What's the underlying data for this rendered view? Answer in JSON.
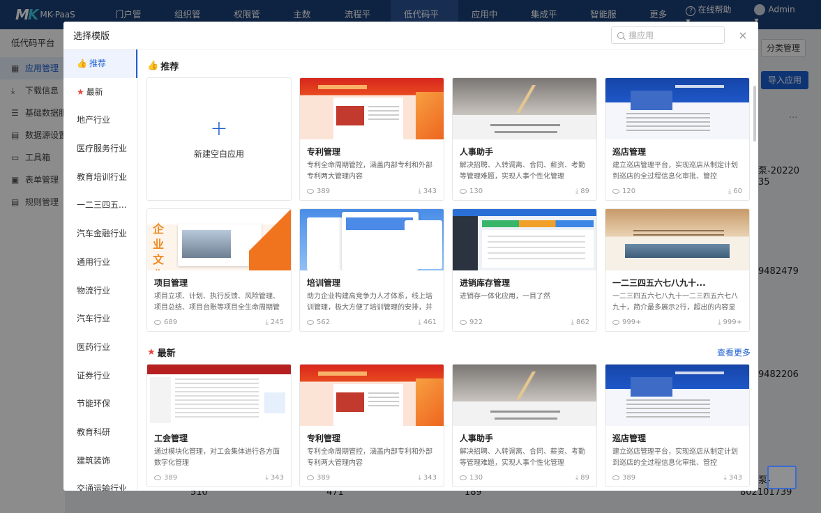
{
  "topbar": {
    "logo": "MK-PaaS",
    "nav": [
      "门户管理",
      "组织管理",
      "权限管理",
      "主数据",
      "流程平台",
      "低代码平台",
      "应用中心",
      "集成平台",
      "智能服务",
      "更多 ▾"
    ],
    "help": "在线帮助 ▾",
    "user": "Admin ▾"
  },
  "bg_sidebar": {
    "title": "低代码平台",
    "items": [
      "应用管理",
      "下载信息",
      "基础数据服务",
      "数据源设置",
      "工具箱",
      "表单管理",
      "规则管理"
    ]
  },
  "bg_right": {
    "category_btn": "分类管理",
    "import_btn": "导入应用",
    "dots": "···",
    "texts": [
      "泵-20220",
      "35",
      "9482479",
      "9482206",
      "泵-",
      "802101739"
    ],
    "bottom": [
      "510",
      "471",
      "189"
    ]
  },
  "modal": {
    "title": "选择模版",
    "search_placeholder": "搜应用",
    "close": "×",
    "categories": [
      "推荐",
      "最新",
      "地产行业",
      "医疗服务行业",
      "教育培训行业",
      "一二三四五...",
      "汽车金融行业",
      "通用行业",
      "物流行业",
      "汽车行业",
      "医药行业",
      "证券行业",
      "节能环保",
      "教育科研",
      "建筑装饰",
      "交通运输行业"
    ],
    "sections": {
      "recommend": "推荐",
      "latest": "最新",
      "more": "查看更多"
    },
    "blank_card": "新建空白应用",
    "recommend_cards": [
      {
        "title": "专利管理",
        "desc": "专利全命周期管控，涵盖内部专利和外部专利两大管理内容",
        "views": "389",
        "downloads": "343",
        "theme": "red"
      },
      {
        "title": "人事助手",
        "desc": "解决招聘、入转调离、合同、薪资、考勤等管理难题，实现人事个性化管理",
        "views": "130",
        "downloads": "89",
        "theme": "gray"
      },
      {
        "title": "巡店管理",
        "desc": " 建立巡店管理平台，实现巡店从制定计划到巡店的全过程信息化审批、管控",
        "views": "120",
        "downloads": "60",
        "theme": "blue"
      },
      {
        "title": "项目管理",
        "desc": "项目立项、计划、执行反馈、风险管理、项目总结、项目台账等项目全生命周期管理",
        "views": "689",
        "downloads": "245",
        "theme": "orange"
      },
      {
        "title": "培训管理",
        "desc": "助力企业构建高竞争力人才体系，线上培训管理，极大方便了培训管理的安排，并且...",
        "views": "562",
        "downloads": "461",
        "theme": "lightblue"
      },
      {
        "title": "进销库存管理",
        "desc": "进销存一体化应用，一目了然",
        "views": "922",
        "downloads": "862",
        "theme": "dash"
      },
      {
        "title": "一二三四五六七八九十...",
        "desc": "一二三四五六七八九十一二三四五六七八九十，简介最多展示2行，超出的内容显示...",
        "views": "999+",
        "downloads": "999+",
        "theme": "beige"
      }
    ],
    "latest_cards": [
      {
        "title": "工会管理",
        "desc": "通过模块化管理，对工会集体进行各方面数字化管理",
        "views": "389",
        "downloads": "343",
        "theme": "table"
      },
      {
        "title": "专利管理",
        "desc": "专利全命周期管控，涵盖内部专利和外部专利两大管理内容",
        "views": "389",
        "downloads": "343",
        "theme": "red"
      },
      {
        "title": "人事助手",
        "desc": "解决招聘、入转调离、合同、薪资、考勤等管理难题，实现人事个性化管理",
        "views": "130",
        "downloads": "89",
        "theme": "gray"
      },
      {
        "title": "巡店管理",
        "desc": " 建立巡店管理平台，实现巡店从制定计划到巡店的全过程信息化审批、管控",
        "views": "389",
        "downloads": "343",
        "theme": "blue"
      }
    ]
  }
}
